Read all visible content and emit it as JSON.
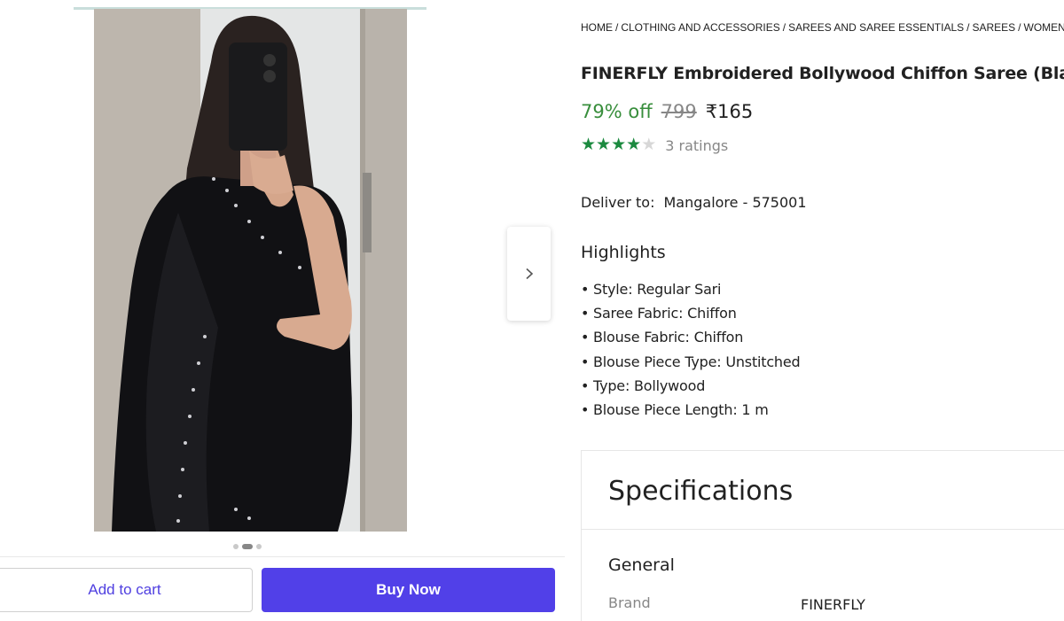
{
  "breadcrumb": [
    "HOME",
    "CLOTHING AND ACCESSORIES",
    "SAREES AND SAREE ESSENTIALS",
    "SAREES",
    "WOMEN"
  ],
  "breadcrumb_separator": "/",
  "product": {
    "title": "FINERFLY Embroidered Bollywood Chiffon Saree (Black)",
    "discount": "79% off",
    "mrp": "799",
    "price": "₹165",
    "rating_stars": 4,
    "rating_max": 5,
    "rating_count": "3 ratings"
  },
  "delivery": {
    "label": "Deliver to:",
    "location": "Mangalore - 575001"
  },
  "highlights": {
    "heading": "Highlights",
    "bullet": "•",
    "items": [
      "Style: Regular Sari",
      "Saree Fabric: Chiffon",
      "Blouse Fabric: Chiffon",
      "Blouse Piece Type: Unstitched",
      "Type: Bollywood",
      "Blouse Piece Length: 1 m"
    ]
  },
  "specifications": {
    "heading": "Specifications",
    "section": "General",
    "rows": [
      {
        "key": "Brand",
        "value": "FINERFLY"
      }
    ]
  },
  "gallery": {
    "image_count": 3,
    "active_index": 1,
    "next_icon": "chevron-right-icon"
  },
  "actions": {
    "add_to_cart": "Add to cart",
    "buy_now": "Buy Now"
  },
  "colors": {
    "accent": "#5140e8",
    "discount": "#388e3c",
    "star": "#1b8a3f"
  }
}
